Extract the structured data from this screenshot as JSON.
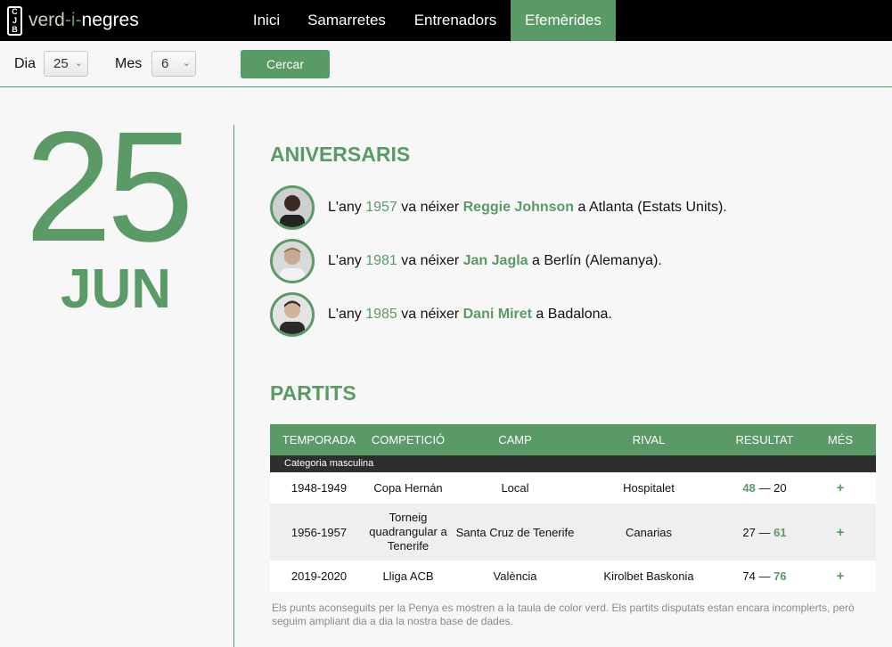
{
  "nav": {
    "logo_badge": [
      "C",
      "J",
      "B"
    ],
    "logo_part1": "verd",
    "logo_part2": "-i-",
    "logo_part3": "negres",
    "items": [
      "Inici",
      "Samarretes",
      "Entrenadors",
      "Efemèrides"
    ],
    "active": "Efemèrides"
  },
  "filters": {
    "day_label": "Dia",
    "day_value": "25",
    "month_label": "Mes",
    "month_value": "6",
    "search_label": "Cercar"
  },
  "date": {
    "day": "25",
    "month": "JUN"
  },
  "anniversaries": {
    "title": "ANIVERSARIS",
    "items": [
      {
        "prefix": "L'any",
        "year": "1957",
        "verb": "va néixer",
        "name": "Reggie Johnson",
        "place": "a Atlanta (Estats Units)."
      },
      {
        "prefix": "L'any",
        "year": "1981",
        "verb": "va néixer",
        "name": "Jan Jagla",
        "place": "a Berlín (Alemanya)."
      },
      {
        "prefix": "L'any",
        "year": "1985",
        "verb": "va néixer",
        "name": "Dani Miret",
        "place": "a Badalona."
      }
    ]
  },
  "matches": {
    "title": "PARTITS",
    "headers": [
      "TEMPORADA",
      "COMPETICIÓ",
      "CAMP",
      "RIVAL",
      "RESULTAT",
      "MÉS"
    ],
    "category": "Categoria masculina",
    "rows": [
      {
        "season": "1948-1949",
        "competition": "Copa Hernán",
        "venue": "Local",
        "rival": "Hospitalet",
        "score_a": "48",
        "sep": "—",
        "score_b": "20",
        "more": "+"
      },
      {
        "season": "1956-1957",
        "competition": "Torneig quadrangular a Tenerife",
        "venue": "Santa Cruz de Tenerife",
        "rival": "Canarias",
        "score_a": "27",
        "sep": "—",
        "score_b": "61",
        "more": "+"
      },
      {
        "season": "2019-2020",
        "competition": "Lliga ACB",
        "venue": "València",
        "rival": "Kirolbet Baskonia",
        "score_a": "74",
        "sep": "—",
        "score_b": "76",
        "more": "+"
      }
    ],
    "footnote": "Els punts aconseguits per la Penya es mostren a la taula de color verd. Els partits disputats estan encara incomplerts, però seguim ampliant dia a dia la nostra base de dades."
  },
  "colors": {
    "accent": "#5a9a66",
    "nav_bg": "#000000",
    "category_bg": "#2e2e2e"
  }
}
